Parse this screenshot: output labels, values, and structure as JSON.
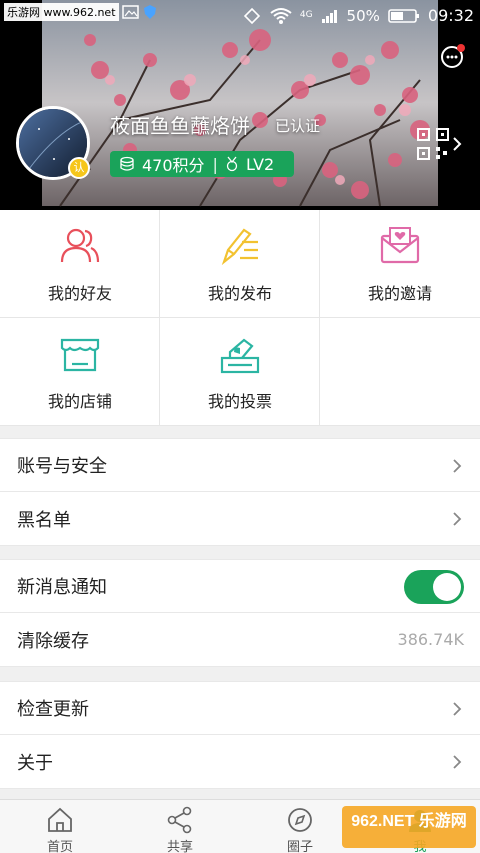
{
  "status_bar": {
    "watermark_text": "乐游网 www.962.net",
    "battery_percent": "50%",
    "time": "09:32",
    "network": "4G"
  },
  "profile": {
    "username": "莜面鱼鱼蘸烙饼",
    "verified_label": "已认证",
    "avatar_badge": "认",
    "points": "470积分",
    "level": "LV2"
  },
  "grid": {
    "items": [
      {
        "label": "我的好友",
        "icon": "friends-icon"
      },
      {
        "label": "我的发布",
        "icon": "publish-icon"
      },
      {
        "label": "我的邀请",
        "icon": "invite-icon"
      },
      {
        "label": "我的店铺",
        "icon": "shop-icon"
      },
      {
        "label": "我的投票",
        "icon": "vote-icon"
      }
    ]
  },
  "settings": {
    "account_security": "账号与安全",
    "blacklist": "黑名单",
    "notifications": "新消息通知",
    "notifications_on": true,
    "clear_cache": "清除缓存",
    "cache_size": "386.74K",
    "check_update": "检查更新",
    "about": "关于"
  },
  "tabbar": {
    "tabs": [
      {
        "label": "首页",
        "icon": "home-icon"
      },
      {
        "label": "共享",
        "icon": "share-icon"
      },
      {
        "label": "圈子",
        "icon": "compass-icon"
      },
      {
        "label": "我",
        "icon": "me-icon"
      }
    ],
    "active_tab": "我",
    "watermark": "962.NET 乐游网"
  },
  "colors": {
    "accent_green": "#1aa35a",
    "friends_red": "#e8505b",
    "publish_yellow": "#f2c230",
    "invite_pink": "#e06aa8",
    "shop_teal": "#2bb5a3"
  }
}
